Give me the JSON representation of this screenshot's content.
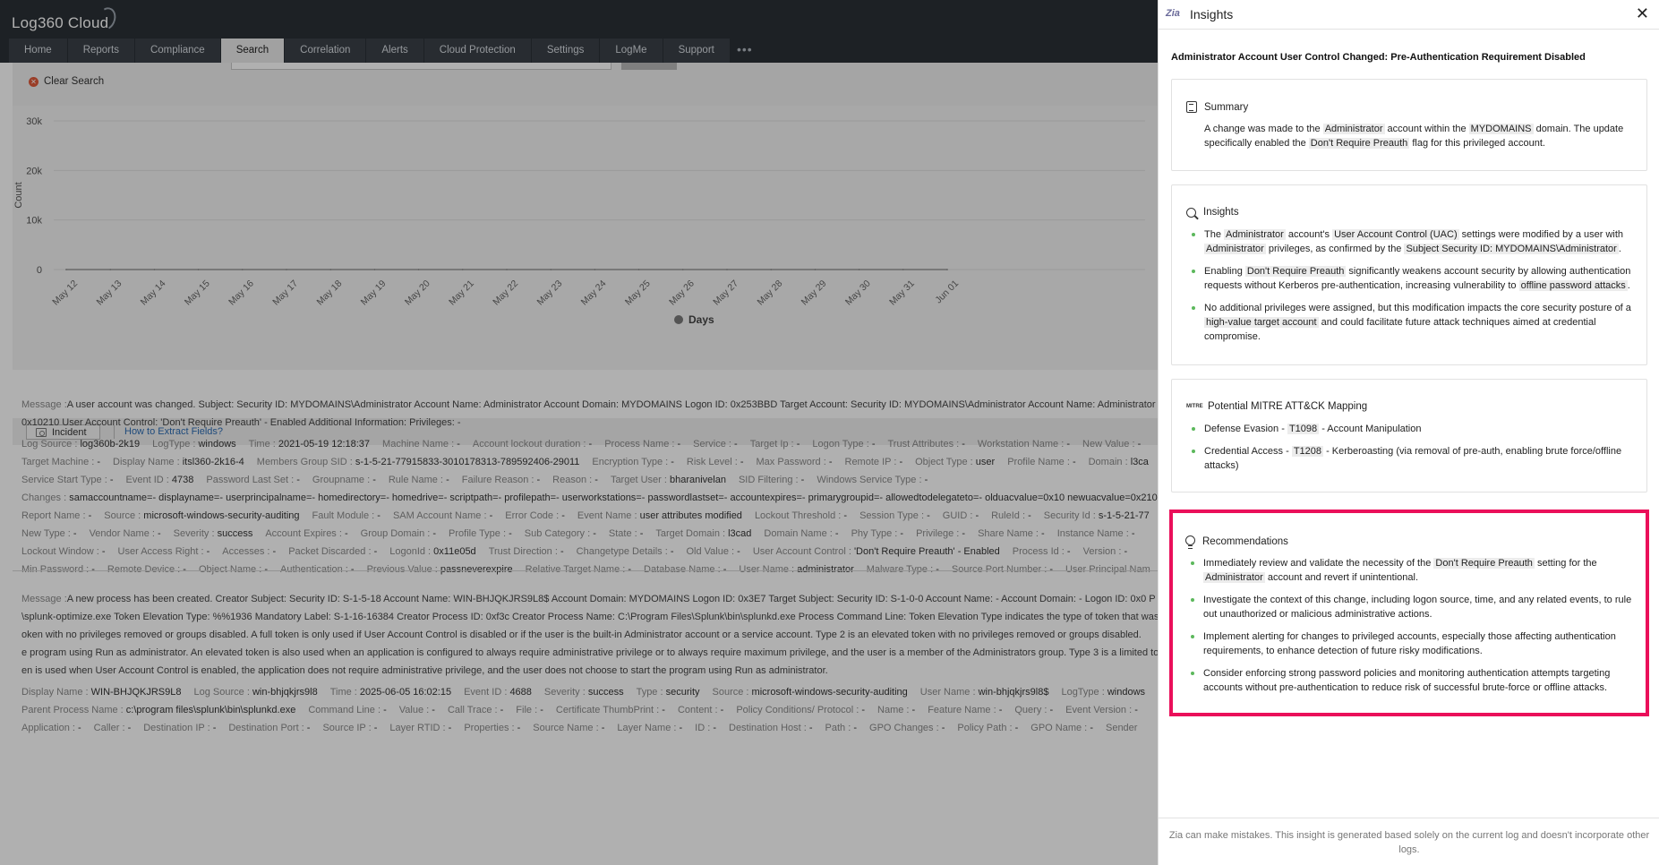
{
  "app": {
    "logo_text": "Log360 Cloud",
    "nav_tabs": [
      "Home",
      "Reports",
      "Compliance",
      "Search",
      "Correlation",
      "Alerts",
      "Cloud Protection",
      "Settings",
      "LogMe",
      "Support"
    ],
    "active_tab": "Search",
    "more_label": "•••"
  },
  "search": {
    "clear_label": "Clear Search"
  },
  "chart_data": {
    "type": "line",
    "x": [
      "May 12",
      "May 13",
      "May 14",
      "May 15",
      "May 16",
      "May 17",
      "May 18",
      "May 19",
      "May 20",
      "May 21",
      "May 22",
      "May 23",
      "May 24",
      "May 25",
      "May 26",
      "May 27",
      "May 28",
      "May 29",
      "May 30",
      "May 31",
      "Jun 01"
    ],
    "series": [
      {
        "name": "Days",
        "values": [
          0,
          0,
          0,
          0,
          0,
          0,
          0,
          0,
          0,
          0,
          0,
          0,
          0,
          0,
          0,
          0,
          0,
          0,
          0,
          0,
          0
        ]
      }
    ],
    "ylabel": "Count",
    "yticks": [
      "0",
      "10k",
      "20k",
      "30k"
    ],
    "ylim": [
      0,
      30000
    ],
    "grid": true,
    "legend": "bottom",
    "series_color": "#6b6b6b"
  },
  "incident": {
    "button_label": "Incident",
    "extract_link": "How to Extract Fields?"
  },
  "logs": [
    {
      "message_label": "Message :",
      "message_lines": [
        "A user account was changed. Subject: Security ID: MYDOMAINS\\Administrator Account Name: Administrator Account Domain: MYDOMAINS Logon ID: 0x253BBD Target Account: Security ID: MYDOMAINS\\Administrator Account Name: Administrator",
        "0x10210 User Account Control: 'Don't Require Preauth' - Enabled Additional Information: Privileges: -"
      ],
      "field_rows": [
        [
          [
            "Log Source",
            "log360b-2k19"
          ],
          [
            "LogType",
            "windows"
          ],
          [
            "Time",
            "2021-05-19 12:18:37"
          ],
          [
            "Machine Name",
            "-"
          ],
          [
            "Account lockout duration",
            "-"
          ],
          [
            "Process Name",
            "-"
          ],
          [
            "Service",
            "-"
          ],
          [
            "Target Ip",
            "-"
          ],
          [
            "Logon Type",
            "-"
          ],
          [
            "Trust Attributes",
            "-"
          ],
          [
            "Workstation Name",
            "-"
          ],
          [
            "New Value",
            "-"
          ]
        ],
        [
          [
            "Target Machine",
            "-"
          ],
          [
            "Display Name",
            "itsl360-2k16-4"
          ],
          [
            "Members Group SID",
            "s-1-5-21-77915833-3010178313-789592406-29011"
          ],
          [
            "Encryption Type",
            "-"
          ],
          [
            "Risk Level",
            "-"
          ],
          [
            "Max Password",
            "-"
          ],
          [
            "Remote IP",
            "-"
          ],
          [
            "Object Type",
            "user"
          ],
          [
            "Profile Name",
            "-"
          ],
          [
            "Domain",
            "l3ca"
          ]
        ],
        [
          [
            "Service Start Type",
            "-"
          ],
          [
            "Event ID",
            "4738"
          ],
          [
            "Password Last Set",
            "-"
          ],
          [
            "Groupname",
            "-"
          ],
          [
            "Rule Name",
            "-"
          ],
          [
            "Failure Reason",
            "-"
          ],
          [
            "Reason",
            "-"
          ],
          [
            "Target User",
            "bharanivelan"
          ],
          [
            "SID Filtering",
            "-"
          ],
          [
            "Windows Service Type",
            "-"
          ]
        ],
        [
          [
            "Changes",
            "samaccountname=- displayname=- userprincipalname=- homedirectory=- homedrive=- scriptpath=- profilepath=- userworkstations=- passwordlastset=- accountexpires=- primarygroupid=- allowedtodelegateto=- olduacvalue=0x10 newuacvalue=0x210"
          ]
        ],
        [
          [
            "Report Name",
            "-"
          ],
          [
            "Source",
            "microsoft-windows-security-auditing"
          ],
          [
            "Fault Module",
            "-"
          ],
          [
            "SAM Account Name",
            "-"
          ],
          [
            "Error Code",
            "-"
          ],
          [
            "Event Name",
            "user attributes modified"
          ],
          [
            "Lockout Threshold",
            "-"
          ],
          [
            "Session Type",
            "-"
          ],
          [
            "GUID",
            "-"
          ],
          [
            "RuleId",
            "-"
          ],
          [
            "Security Id",
            "s-1-5-21-77"
          ]
        ],
        [
          [
            "New Type",
            "-"
          ],
          [
            "Vendor Name",
            "-"
          ],
          [
            "Severity",
            "success"
          ],
          [
            "Account Expires",
            "-"
          ],
          [
            "Group Domain",
            "-"
          ],
          [
            "Profile Type",
            "-"
          ],
          [
            "Sub Category",
            "-"
          ],
          [
            "State",
            "-"
          ],
          [
            "Target Domain",
            "l3cad"
          ],
          [
            "Domain Name",
            "-"
          ],
          [
            "Phy Type",
            "-"
          ],
          [
            "Privilege",
            "-"
          ],
          [
            "Share Name",
            "-"
          ],
          [
            "Instance Name",
            "-"
          ]
        ],
        [
          [
            "Lockout Window",
            "-"
          ],
          [
            "User Access Right",
            "-"
          ],
          [
            "Accesses",
            "-"
          ],
          [
            "Packet Discarded",
            "-"
          ],
          [
            "LogonId",
            "0x11e05d"
          ],
          [
            "Trust Direction",
            "-"
          ],
          [
            "Changetype Details",
            "-"
          ],
          [
            "Old Value",
            "-"
          ],
          [
            "User Account Control",
            "'Don't Require Preauth' - Enabled"
          ],
          [
            "Process Id",
            "-"
          ],
          [
            "Version",
            "-"
          ]
        ],
        [
          [
            "Min Password",
            "-"
          ],
          [
            "Remote Device",
            "-"
          ],
          [
            "Object Name",
            "-"
          ],
          [
            "Authentication",
            "-"
          ],
          [
            "Previous Value",
            "passneverexpire"
          ],
          [
            "Relative Target Name",
            "-"
          ],
          [
            "Database Name",
            "-"
          ],
          [
            "User Name",
            "administrator"
          ],
          [
            "Malware Type",
            "-"
          ],
          [
            "Source Port Number",
            "-"
          ],
          [
            "User Principal Nam",
            ""
          ]
        ]
      ]
    },
    {
      "message_label": "Message :",
      "message_lines": [
        "A new process has been created. Creator Subject: Security ID: S-1-5-18 Account Name: WIN-BHJQKJRS9L8$ Account Domain: MYDOMAINS Logon ID: 0x3E7 Target Subject: Security ID: S-1-0-0 Account Name: - Account Domain: - Logon ID: 0x0 P",
        "\\splunk-optimize.exe Token Elevation Type: %%1936 Mandatory Label: S-1-16-16384 Creator Process ID: 0xf3c Creator Process Name: C:\\Program Files\\Splunk\\bin\\splunkd.exe Process Command Line: Token Elevation Type indicates the type of token that was",
        "oken with no privileges removed or groups disabled. A full token is only used if User Account Control is disabled or if the user is the built-in Administrator account or a service account. Type 2 is an elevated token with no privileges removed or groups disabled.",
        "e program using Run as administrator. An elevated token is also used when an application is configured to always require administrative privilege or to always require maximum privilege, and the user is a member of the Administrators group. Type 3 is a limited to",
        "en is used when User Account Control is enabled, the application does not require administrative privilege, and the user does not choose to start the program using Run as administrator."
      ],
      "field_rows": [
        [
          [
            "Display Name",
            "WIN-BHJQKJRS9L8"
          ],
          [
            "Log Source",
            "win-bhjqkjrs9l8"
          ],
          [
            "Time",
            "2025-06-05 16:02:15"
          ],
          [
            "Event ID",
            "4688"
          ],
          [
            "Severity",
            "success"
          ],
          [
            "Type",
            "security"
          ],
          [
            "Source",
            "microsoft-windows-security-auditing"
          ],
          [
            "User Name",
            "win-bhjqkjrs9l8$"
          ],
          [
            "LogType",
            "windows"
          ]
        ],
        [
          [
            "Parent Process Name",
            "c:\\program files\\splunk\\bin\\splunkd.exe"
          ],
          [
            "Command Line",
            "-"
          ],
          [
            "Value",
            "-"
          ],
          [
            "Call Trace",
            "-"
          ],
          [
            "File",
            "-"
          ],
          [
            "Certificate ThumbPrint",
            "-"
          ],
          [
            "Content",
            "-"
          ],
          [
            "Policy Conditions/ Protocol",
            "-"
          ],
          [
            "Name",
            "-"
          ],
          [
            "Feature Name",
            "-"
          ],
          [
            "Query",
            "-"
          ],
          [
            "Event Version",
            "-"
          ]
        ],
        [
          [
            "Application",
            "-"
          ],
          [
            "Caller",
            "-"
          ],
          [
            "Destination IP",
            "-"
          ],
          [
            "Destination Port",
            "-"
          ],
          [
            "Source IP",
            "-"
          ],
          [
            "Layer RTID",
            "-"
          ],
          [
            "Properties",
            "-"
          ],
          [
            "Source Name",
            "-"
          ],
          [
            "Layer Name",
            "-"
          ],
          [
            "ID",
            "-"
          ],
          [
            "Destination Host",
            "-"
          ],
          [
            "Path",
            "-"
          ],
          [
            "GPO Changes",
            "-"
          ],
          [
            "Policy Path",
            "-"
          ],
          [
            "GPO Name",
            "-"
          ],
          [
            "Sender",
            ""
          ]
        ]
      ]
    }
  ],
  "panel": {
    "title": "Insights",
    "close_label": "✕",
    "zia_label": "Zia",
    "alert_title": "Administrator Account User Control Changed: Pre-Authentication Requirement Disabled",
    "summary": {
      "heading": "Summary",
      "parts": [
        [
          "A change was made to the ",
          false
        ],
        [
          "Administrator",
          true
        ],
        [
          " account within the ",
          false
        ],
        [
          "MYDOMAINS",
          true
        ],
        [
          " domain. The update specifically enabled the ",
          false
        ],
        [
          "Don't Require Preauth",
          true
        ],
        [
          " flag for this privileged account.",
          false
        ]
      ]
    },
    "insights": {
      "heading": "Insights",
      "items": [
        [
          [
            "The ",
            false
          ],
          [
            "Administrator",
            true
          ],
          [
            " account's ",
            false
          ],
          [
            "User Account Control (UAC)",
            true
          ],
          [
            " settings were modified by a user with ",
            false
          ],
          [
            "Administrator",
            true
          ],
          [
            " privileges, as confirmed by the ",
            false
          ],
          [
            "Subject Security ID: MYDOMAINS\\Administrator",
            true
          ],
          [
            ".",
            false
          ]
        ],
        [
          [
            "Enabling ",
            false
          ],
          [
            "Don't Require Preauth",
            true
          ],
          [
            " significantly weakens account security by allowing authentication requests without Kerberos pre-authentication, increasing vulnerability to ",
            false
          ],
          [
            "offline password attacks",
            true
          ],
          [
            ".",
            false
          ]
        ],
        [
          [
            "No additional privileges were assigned, but this modification impacts the core security posture of a ",
            false
          ],
          [
            "high-value target account",
            true
          ],
          [
            " and could facilitate future attack techniques aimed at credential compromise.",
            false
          ]
        ]
      ]
    },
    "mitre": {
      "heading": "Potential MITRE ATT&CK Mapping",
      "icon_text": "MITRE",
      "items": [
        [
          [
            "Defense Evasion - ",
            false
          ],
          [
            "T1098",
            true
          ],
          [
            " - Account Manipulation",
            false
          ]
        ],
        [
          [
            "Credential Access - ",
            false
          ],
          [
            "T1208",
            true
          ],
          [
            " - Kerberoasting (via removal of pre-auth, enabling brute force/offline attacks)",
            false
          ]
        ]
      ]
    },
    "recommendations": {
      "heading": "Recommendations",
      "items": [
        [
          [
            "Immediately review and validate the necessity of the ",
            false
          ],
          [
            "Don't Require Preauth",
            true
          ],
          [
            " setting for the ",
            false
          ],
          [
            "Administrator",
            true
          ],
          [
            " account and revert if unintentional.",
            false
          ]
        ],
        [
          [
            "Investigate the context of this change, including logon source, time, and any related events, to rule out unauthorized or malicious administrative actions.",
            false
          ]
        ],
        [
          [
            "Implement alerting for changes to privileged accounts, especially those affecting authentication requirements, to enhance detection of future risky modifications.",
            false
          ]
        ],
        [
          [
            "Consider enforcing strong password policies and monitoring authentication attempts targeting accounts without pre-authentication to reduce risk of successful brute-force or offline attacks.",
            false
          ]
        ]
      ]
    },
    "disclaimer": "Zia can make mistakes. This insight is generated based solely on the current log and doesn't incorporate other logs."
  },
  "colors": {
    "header_bg": "#2b3036",
    "highlight_border": "#ea0f5a",
    "bullet": "#5cb85c",
    "link": "#2d6db4"
  }
}
